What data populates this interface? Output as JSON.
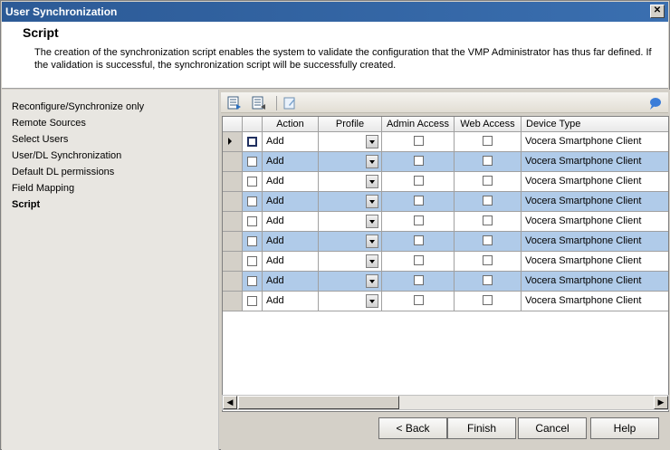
{
  "window": {
    "title": "User Synchronization",
    "close_label": "✕"
  },
  "header": {
    "title": "Script",
    "description": "The creation of the synchronization script enables the system to validate the configuration that the VMP Administrator has thus far defined. If the validation is successful, the synchronization script will be successfully created."
  },
  "nav": {
    "items": [
      {
        "label": "Reconfigure/Synchronize only"
      },
      {
        "label": "Remote Sources"
      },
      {
        "label": "Select Users"
      },
      {
        "label": "User/DL Synchronization"
      },
      {
        "label": "Default DL permissions"
      },
      {
        "label": "Field Mapping"
      },
      {
        "label": "Script"
      }
    ],
    "active_index": 6
  },
  "toolbar": {
    "icons": [
      "grid-export-icon",
      "grid-import-icon",
      "edit-icon",
      "help-balloon-icon"
    ]
  },
  "grid": {
    "columns": [
      "Action",
      "Profile",
      "Admin Access",
      "Web Access",
      "Device Type"
    ],
    "rows": [
      {
        "action": "Add",
        "profile": "",
        "admin": false,
        "web": false,
        "device": "Vocera Smartphone Client"
      },
      {
        "action": "Add",
        "profile": "",
        "admin": false,
        "web": false,
        "device": "Vocera Smartphone Client"
      },
      {
        "action": "Add",
        "profile": "",
        "admin": false,
        "web": false,
        "device": "Vocera Smartphone Client"
      },
      {
        "action": "Add",
        "profile": "",
        "admin": false,
        "web": false,
        "device": "Vocera Smartphone Client"
      },
      {
        "action": "Add",
        "profile": "",
        "admin": false,
        "web": false,
        "device": "Vocera Smartphone Client"
      },
      {
        "action": "Add",
        "profile": "",
        "admin": false,
        "web": false,
        "device": "Vocera Smartphone Client"
      },
      {
        "action": "Add",
        "profile": "",
        "admin": false,
        "web": false,
        "device": "Vocera Smartphone Client"
      },
      {
        "action": "Add",
        "profile": "",
        "admin": false,
        "web": false,
        "device": "Vocera Smartphone Client"
      },
      {
        "action": "Add",
        "profile": "",
        "admin": false,
        "web": false,
        "device": "Vocera Smartphone Client"
      }
    ]
  },
  "buttons": {
    "back": "< Back",
    "finish": "Finish",
    "cancel": "Cancel",
    "help": "Help"
  },
  "colors": {
    "titlebar": "#2c5a96",
    "row_highlight": "#b0cbe9"
  }
}
